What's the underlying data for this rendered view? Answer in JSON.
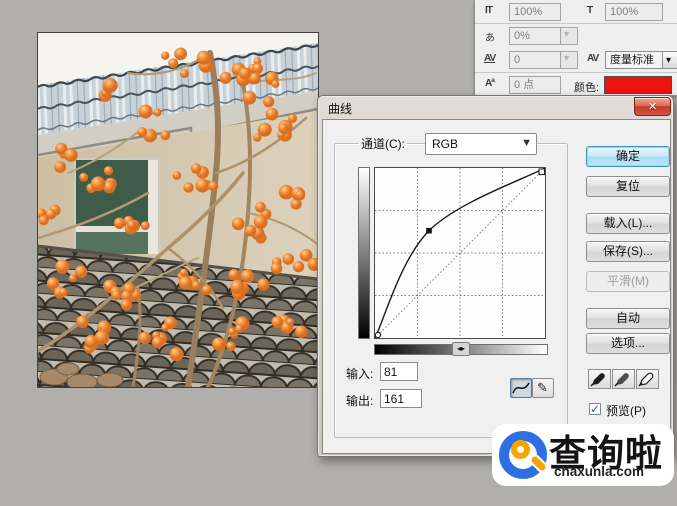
{
  "character_panel": {
    "v_scale_icon": "IT",
    "v_scale": "100%",
    "h_scale_icon": "T",
    "h_scale": "100%",
    "tsume_icon": "あ",
    "tsume": "0%",
    "kerning_icon": "AV",
    "kerning": "0",
    "tracking_icon": "AV",
    "tracking": "度量标准",
    "baseline_icon": "Aª",
    "baseline": "0 点",
    "color_label": "颜色:",
    "color_value": "#ec1313"
  },
  "dialog": {
    "title": "曲线",
    "channel_label": "通道(C):",
    "channel_value": "RGB",
    "buttons": {
      "ok": "确定",
      "reset": "复位",
      "load": "载入(L)...",
      "save": "保存(S)...",
      "smooth": "平滑(M)",
      "auto": "自动",
      "options": "选项..."
    },
    "input_label": "输入:",
    "input_value": "81",
    "output_label": "输出:",
    "output_value": "161",
    "preview_label": "预览(P)",
    "preview_checked": true
  },
  "chart_data": {
    "type": "line",
    "title": "RGB tone curve",
    "channel": "RGB",
    "x_range": [
      0,
      255
    ],
    "y_range": [
      0,
      255
    ],
    "points": [
      [
        0,
        0
      ],
      [
        81,
        161
      ],
      [
        255,
        255
      ]
    ],
    "baseline": [
      [
        0,
        0
      ],
      [
        255,
        255
      ]
    ],
    "grid": "4x4 dotted",
    "selected_point": {
      "input": 81,
      "output": 161
    }
  },
  "watermark": {
    "name": "查询啦",
    "domain": "chaxunla.com",
    "blue": "#2f6fe4",
    "orange": "#f7a400"
  }
}
